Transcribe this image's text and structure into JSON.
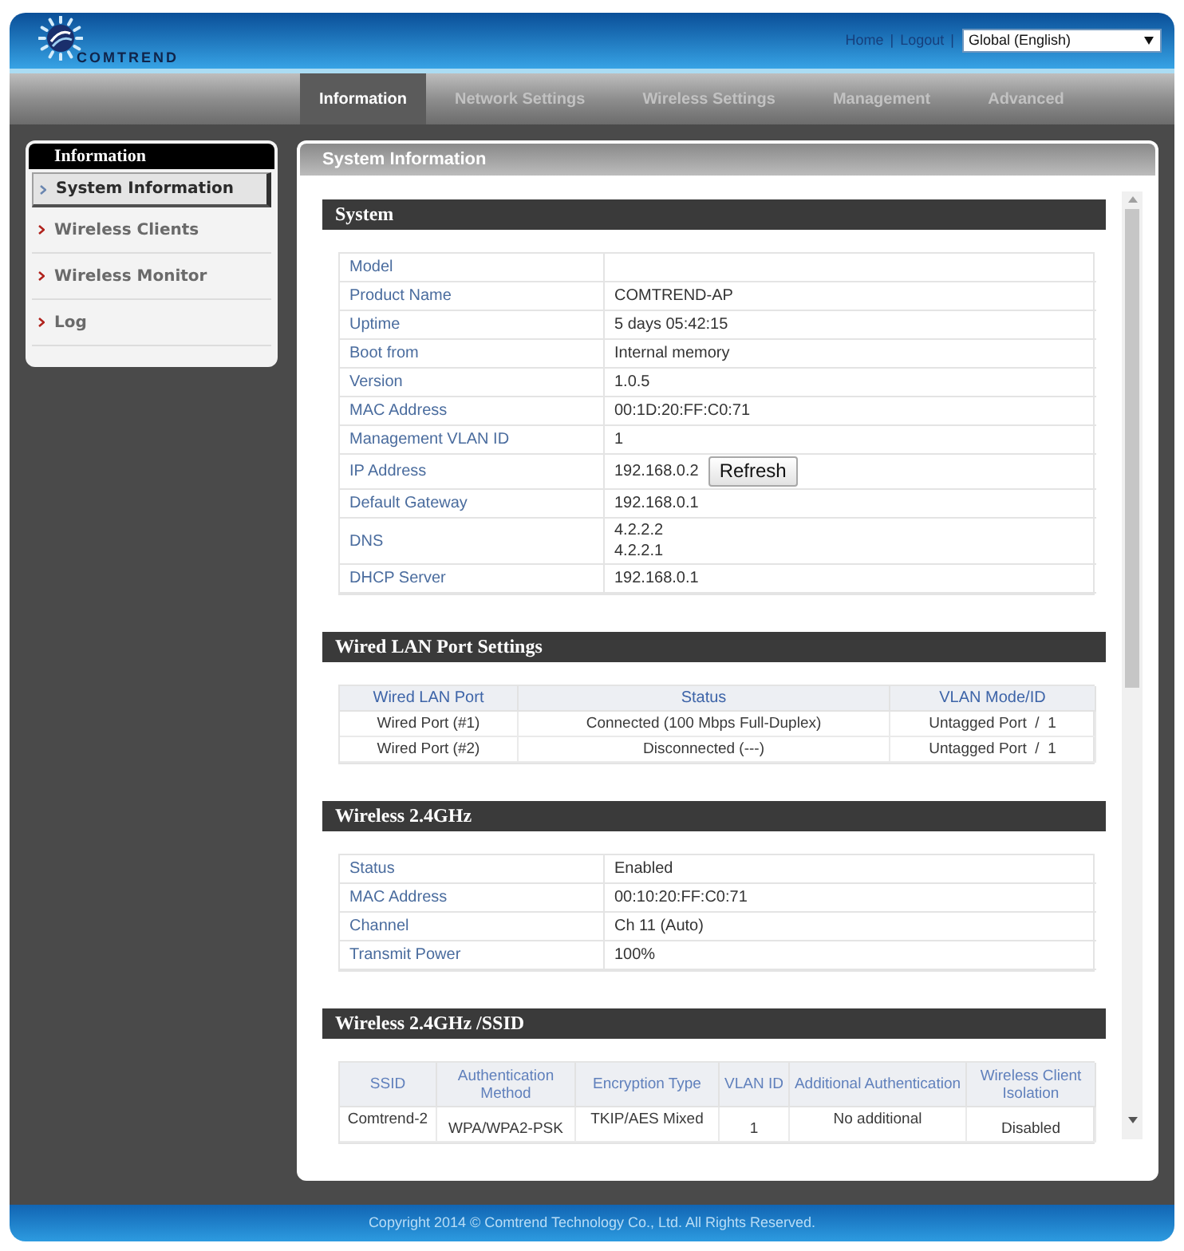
{
  "header": {
    "logo_text": "COMTREND",
    "top_links": [
      {
        "label": "Home",
        "separator": "|"
      },
      {
        "label": "Logout",
        "separator": "|"
      }
    ],
    "language_select": {
      "value": "Global (English)"
    }
  },
  "nav_tabs": [
    {
      "label": "Information",
      "selected": true
    },
    {
      "label": "Network Settings",
      "selected": false
    },
    {
      "label": "Wireless Settings",
      "selected": false
    },
    {
      "label": "Management",
      "selected": false
    },
    {
      "label": "Advanced",
      "selected": false
    }
  ],
  "sidebar": {
    "title": "Information",
    "items": [
      {
        "label": "System Information",
        "selected": true
      },
      {
        "label": "Wireless Clients",
        "selected": false
      },
      {
        "label": "Wireless Monitor",
        "selected": false
      },
      {
        "label": "Log",
        "selected": false
      }
    ]
  },
  "panel": {
    "title": "System Information",
    "sections": [
      {
        "kind": "key_value",
        "title": "System",
        "rows": [
          {
            "label": "Model"
          },
          {
            "label": "Product Name",
            "values": [
              "COMTREND-AP"
            ]
          },
          {
            "label": "Uptime",
            "values": [
              "5 days 05:42:15"
            ]
          },
          {
            "label": "Boot from",
            "values": [
              "Internal memory"
            ]
          },
          {
            "label": "Version",
            "values": [
              "1.0.5"
            ]
          },
          {
            "label": "MAC Address",
            "values": [
              "00:1D:20:FF:C0:71"
            ]
          },
          {
            "label": "Management VLAN ID",
            "values": [
              "1"
            ]
          },
          {
            "label": "IP Address",
            "values": [
              "192.168.0.2"
            ],
            "button": "Refresh"
          },
          {
            "label": "Default Gateway",
            "values": [
              "192.168.0.1"
            ]
          },
          {
            "label": "DNS",
            "values": [
              "4.2.2.2",
              "4.2.2.1"
            ]
          },
          {
            "label": "DHCP Server",
            "values": [
              "192.168.0.1"
            ]
          }
        ]
      },
      {
        "kind": "table",
        "title": "Wired LAN Port Settings",
        "columns": [
          "Wired LAN Port",
          "Status",
          "VLAN Mode/ID"
        ],
        "rows": [
          [
            "Wired Port (#1)",
            "Connected (100 Mbps Full-Duplex)",
            "Untagged Port  /  1"
          ],
          [
            "Wired Port (#2)",
            "Disconnected (---)",
            "Untagged Port  /  1"
          ]
        ]
      },
      {
        "kind": "key_value",
        "title": "Wireless 2.4GHz",
        "rows": [
          {
            "label": "Status",
            "values": [
              "Enabled"
            ]
          },
          {
            "label": "MAC Address",
            "values": [
              "00:10:20:FF:C0:71"
            ]
          },
          {
            "label": "Channel",
            "values": [
              "Ch 11 (Auto)"
            ]
          },
          {
            "label": "Transmit Power",
            "values": [
              "100%"
            ]
          }
        ]
      },
      {
        "kind": "table",
        "title": "Wireless 2.4GHz /SSID",
        "columns": [
          "SSID",
          "Authentication Method",
          "Encryption Type",
          "VLAN ID",
          "Additional Authentication",
          "Wireless Client Isolation"
        ],
        "rows": [
          [
            "Comtrend-2",
            "WPA/WPA2-PSK",
            "TKIP/AES Mixed",
            "1",
            "No additional",
            "Disabled"
          ]
        ]
      }
    ]
  },
  "footer": {
    "copyright": "Copyright 2014 © Comtrend Technology Co., Ltd. All Rights Reserved."
  }
}
